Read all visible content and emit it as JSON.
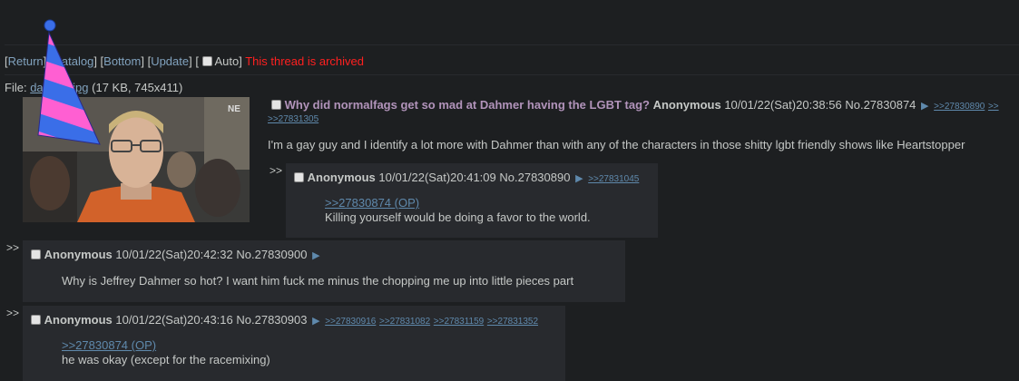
{
  "nav": {
    "return": "Return",
    "catalog": "Catalog",
    "bottom": "Bottom",
    "update": "Update",
    "auto": "Auto",
    "archived": "This thread is archived"
  },
  "file": {
    "label": "File:",
    "name": "dahmer.jpg",
    "meta": "(17 KB, 745x411)"
  },
  "op": {
    "subject": "Why did normalfags get so mad at Dahmer having the LGBT tag?",
    "name": "Anonymous",
    "date": "10/01/22(Sat)20:38:56",
    "no": "No.27830874",
    "backlinks": [
      ">>27830890",
      ">>",
      ">>27831305"
    ],
    "message": "I'm a gay guy and I identify a lot more with Dahmer than with any of the characters in those shitty lgbt friendly shows like Heartstopper"
  },
  "replies": [
    {
      "name": "Anonymous",
      "date": "10/01/22(Sat)20:41:09",
      "no": "No.27830890",
      "backlinks": [
        ">>27831045"
      ],
      "quote": ">>27830874 (OP)",
      "message": "Killing yourself would be doing a favor to the world."
    },
    {
      "name": "Anonymous",
      "date": "10/01/22(Sat)20:42:32",
      "no": "No.27830900",
      "backlinks": [],
      "quote": "",
      "message": "Why is Jeffrey Dahmer so hot? I want him fuck me minus the chopping me up into little pieces part"
    },
    {
      "name": "Anonymous",
      "date": "10/01/22(Sat)20:43:16",
      "no": "No.27830903",
      "backlinks": [
        ">>27830916",
        ">>27831082",
        ">>27831159",
        ">>27831352"
      ],
      "quote": ">>27830874 (OP)",
      "message": "he was okay (except for the racemixing)"
    }
  ],
  "side_arrows": ">>",
  "post_arrow": "▶",
  "colors": {
    "background": "#1d1f21",
    "reply_bg": "#282a2e",
    "subject": "#b294bb",
    "link": "#5f89ac",
    "archived": "#ff2020"
  }
}
